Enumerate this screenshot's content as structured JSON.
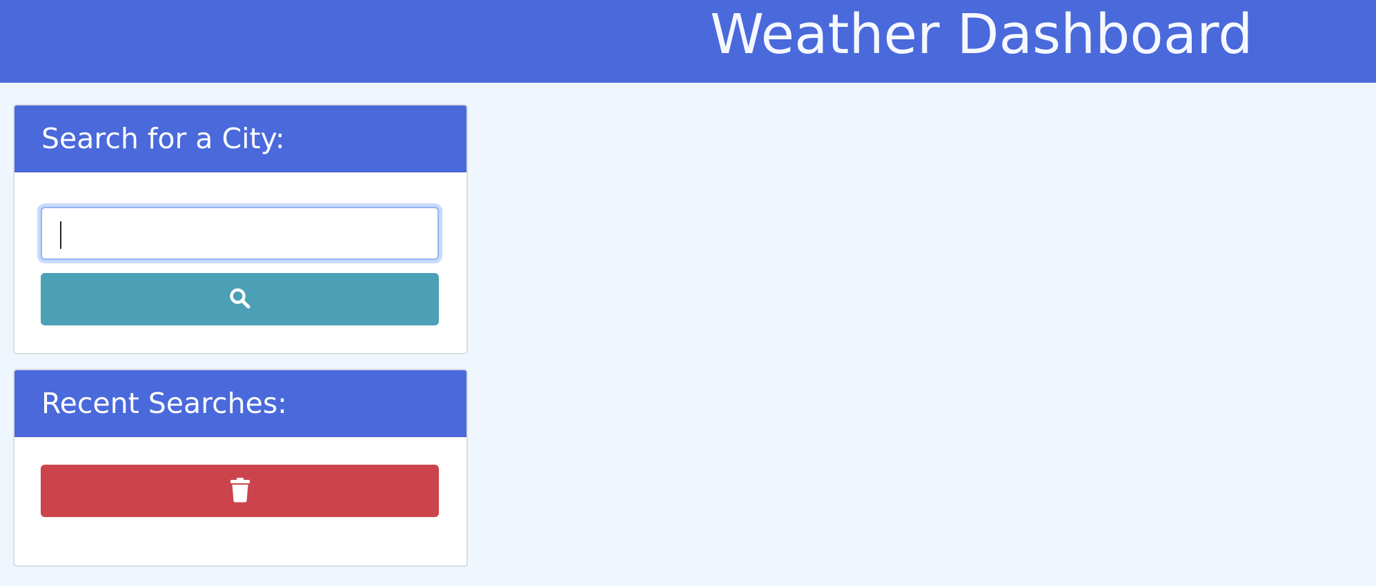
{
  "navbar": {
    "title": "Weather Dashboard"
  },
  "search_card": {
    "header": "Search for a City:",
    "input": {
      "value": "",
      "placeholder": ""
    },
    "button_icon": "search-icon"
  },
  "recent_card": {
    "header": "Recent Searches:",
    "items": [],
    "button_icon": "trash-icon"
  },
  "colors": {
    "primary": "#4a69db",
    "page_background": "#eff6fe",
    "search_button": "#4ba0b6",
    "clear_button": "#cc444b"
  }
}
